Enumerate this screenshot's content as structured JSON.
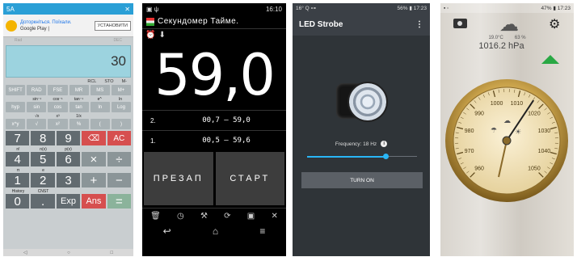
{
  "calc": {
    "status_left": "5A",
    "status_right": "✕",
    "ad_line1": "Доторкніться. Поїхали.",
    "ad_line2": "Google Play |",
    "ad_button": "УСТАНОВИТИ",
    "mode_left": "Rad",
    "mode_right": "DEC",
    "display_value": "30",
    "mem_keys": [
      "RCL",
      "STO",
      "M-"
    ],
    "sci_row1": [
      "SHIFT",
      "RAD",
      "FSE",
      "MR",
      "MS",
      "M+"
    ],
    "sci_sub1": [
      "",
      "sin⁻¹",
      "cos⁻¹",
      "tan⁻¹",
      "e^",
      "ln"
    ],
    "sci_row2": [
      "hyp",
      "sin",
      "cos",
      "tan",
      "ln",
      "Log"
    ],
    "sci_sub2": [
      "",
      "√x",
      "x³",
      "1/x",
      "",
      ""
    ],
    "sci_row3": [
      "x^y",
      "√",
      "x²",
      "%",
      "(",
      ")"
    ],
    "num_row1": [
      "7",
      "8",
      "9",
      "⌫",
      "AC"
    ],
    "num_sub1": [
      "n!",
      "n(x)",
      "p(x)",
      "",
      ""
    ],
    "num_row2": [
      "4",
      "5",
      "6",
      "×",
      "÷"
    ],
    "num_sub2": [
      "π",
      "e",
      "",
      "",
      ""
    ],
    "num_row3": [
      "1",
      "2",
      "3",
      "+",
      "−"
    ],
    "num_sub3": [
      "History",
      "CNST",
      "",
      "",
      ""
    ],
    "num_row4": [
      "0",
      ".",
      "Exp",
      "Ans",
      "="
    ]
  },
  "stopwatch": {
    "status_left": "▣ ψ",
    "status_time": "16:10",
    "title": "Секундомер Тайме.",
    "big_time": "59,0",
    "laps": [
      {
        "n": "2.",
        "v": "00,7 — 59,0"
      },
      {
        "n": "1.",
        "v": "00,5 — 59,6"
      }
    ],
    "reset_label": "ПРЕЗАП",
    "start_label": "СТАРТ"
  },
  "strobe": {
    "status_left": "16° Q ⊶",
    "status_right": "56% ▮ 17:23",
    "title": "LED Strobe",
    "frequency_label": "Frequency: 18 Hz",
    "info_glyph": "i",
    "slider_fraction": 0.71,
    "turn_on_label": "TURN ON"
  },
  "barometer": {
    "status_right": "47% ▮ 17:23",
    "temperature": "19.0°C",
    "humidity": "63 %",
    "pressure": "1016.2 hPa",
    "dial_labels": [
      "960",
      "970",
      "980",
      "990",
      "1000",
      "1010",
      "1020",
      "1030",
      "1040",
      "1050"
    ],
    "needle_value": 1016.2
  }
}
